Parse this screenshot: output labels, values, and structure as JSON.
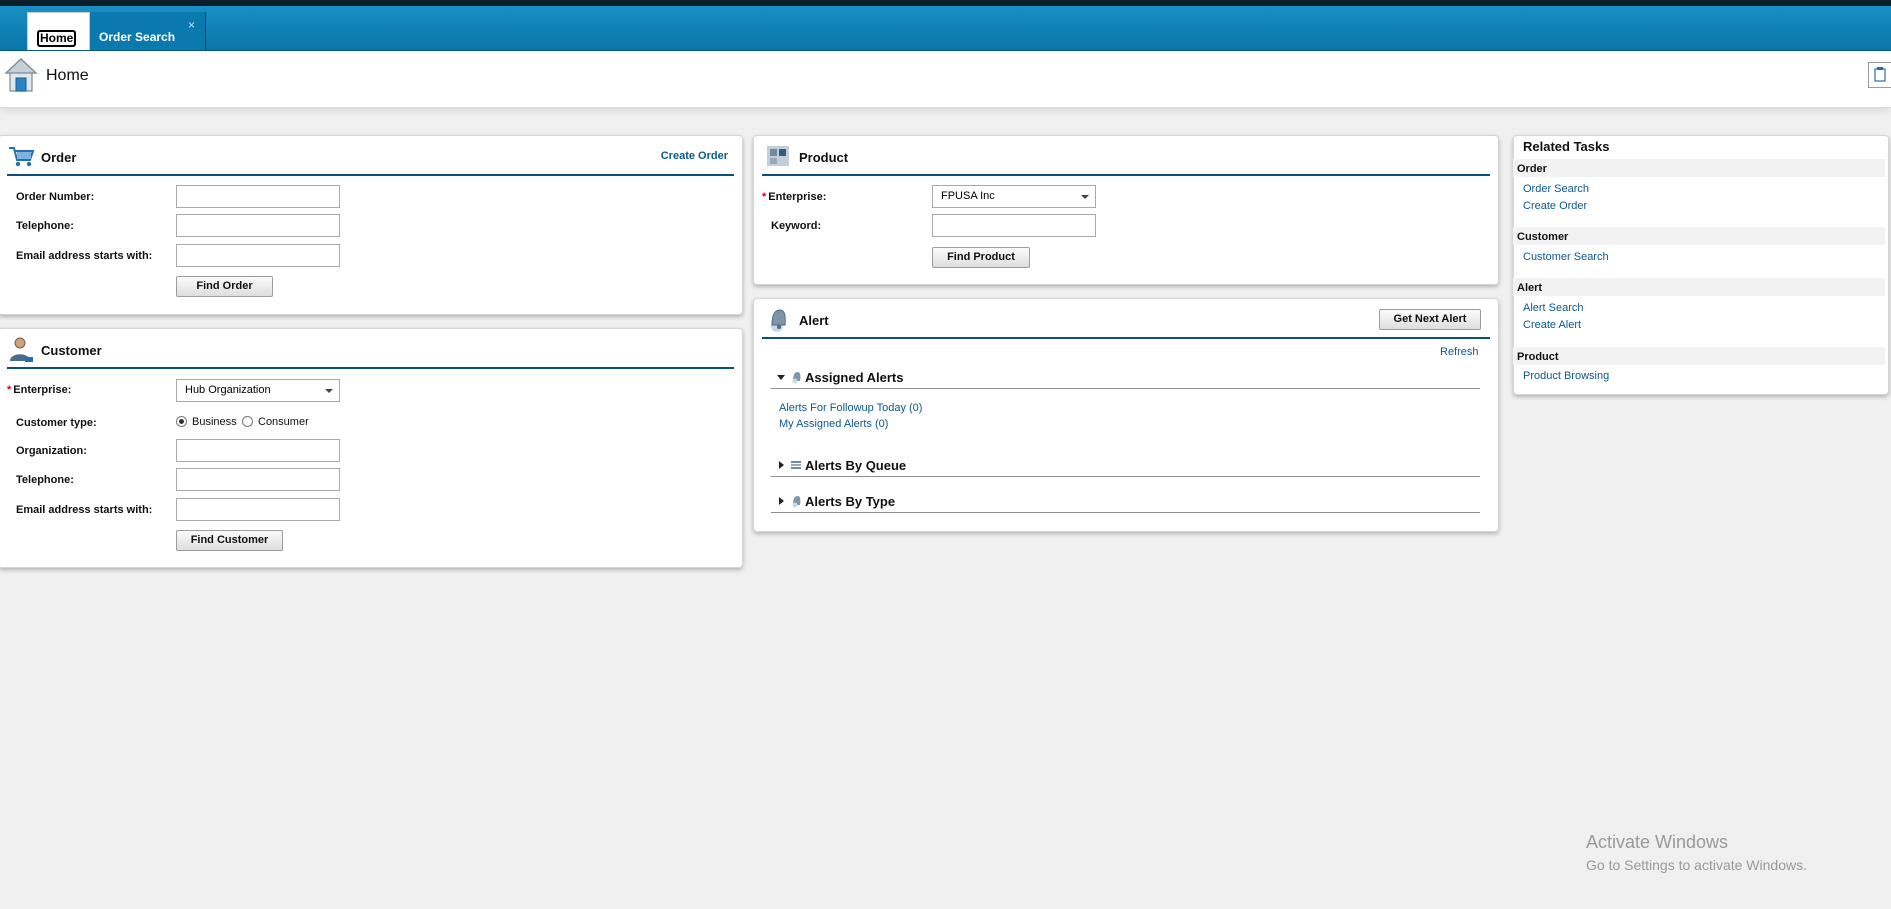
{
  "tabs": [
    {
      "label": "Home"
    },
    {
      "label": "Order Search",
      "close": "×"
    }
  ],
  "page": {
    "title": "Home"
  },
  "order": {
    "title": "Order",
    "create_link": "Create Order",
    "fields": {
      "order_number": "Order Number:",
      "telephone": "Telephone:",
      "email": "Email address starts with:"
    },
    "values": {
      "order_number": "",
      "telephone": "",
      "email": ""
    },
    "find_button": "Find Order"
  },
  "customer": {
    "title": "Customer",
    "req": "*",
    "fields": {
      "enterprise": "Enterprise:",
      "customer_type": "Customer type:",
      "organization": "Organization:",
      "telephone": "Telephone:",
      "email": "Email address starts with:"
    },
    "enterprise_value": "Hub Organization",
    "radio_business": "Business",
    "radio_consumer": "Consumer",
    "selected_type": "Business",
    "find_button": "Find Customer"
  },
  "product": {
    "title": "Product",
    "req": "*",
    "enterprise_label": "Enterprise:",
    "enterprise_value": "FPUSA Inc",
    "keyword_label": "Keyword:",
    "find_button": "Find Product"
  },
  "alert": {
    "title": "Alert",
    "next_button": "Get Next Alert",
    "refresh": "Refresh",
    "assigned": {
      "title": "Assigned Alerts",
      "links": [
        "Alerts For Followup Today (0)",
        "My Assigned Alerts (0)"
      ]
    },
    "by_queue": "Alerts By Queue",
    "by_type": "Alerts By Type"
  },
  "related": {
    "title": "Related Tasks",
    "sections": [
      {
        "name": "Order",
        "links": [
          "Order Search",
          "Create Order"
        ]
      },
      {
        "name": "Customer",
        "links": [
          "Customer Search"
        ]
      },
      {
        "name": "Alert",
        "links": [
          "Alert Search",
          "Create Alert"
        ]
      },
      {
        "name": "Product",
        "links": [
          "Product Browsing"
        ]
      }
    ]
  },
  "watermark": {
    "line1": "Activate Windows",
    "line2": "Go to Settings to activate Windows."
  },
  "colors": {
    "tabbar": "#0a74a8",
    "header_rule": "#0b4f7a",
    "link": "#0b5a8f",
    "required": "#d0021b"
  }
}
